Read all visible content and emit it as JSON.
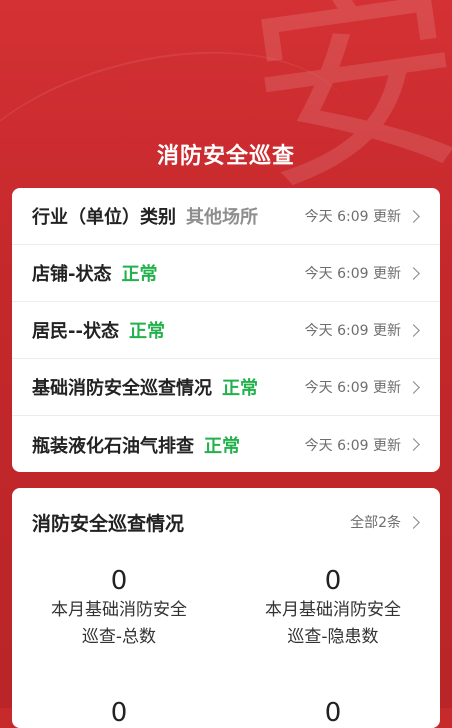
{
  "page_title": "消防安全巡查",
  "status_rows": [
    {
      "label": "行业（单位）类别",
      "value": "其他场所",
      "value_type": "other",
      "updated": "今天 6:09 更新"
    },
    {
      "label": "店铺-状态",
      "value": "正常",
      "value_type": "ok",
      "updated": "今天 6:09 更新"
    },
    {
      "label": "居民--状态",
      "value": "正常",
      "value_type": "ok",
      "updated": "今天 6:09 更新"
    },
    {
      "label": "基础消防安全巡查情况",
      "value": "正常",
      "value_type": "ok",
      "updated": "今天 6:09 更新"
    },
    {
      "label": "瓶装液化石油气排查",
      "value": "正常",
      "value_type": "ok",
      "updated": "今天 6:09 更新"
    }
  ],
  "inspection_card": {
    "title": "消防安全巡查情况",
    "all_link": "全部2条",
    "stats": [
      {
        "value": "0",
        "label_line1": "本月基础消防安全",
        "label_line2": "巡查-总数"
      },
      {
        "value": "0",
        "label_line1": "本月基础消防安全",
        "label_line2": "巡查-隐患数"
      },
      {
        "value": "0",
        "label_line1": "",
        "label_line2": ""
      },
      {
        "value": "0",
        "label_line1": "",
        "label_line2": ""
      }
    ]
  },
  "background": {
    "watermark_char": "安"
  },
  "colors": {
    "primary_red": "#c62a2b",
    "status_ok": "#22b14c",
    "status_other": "#8e8e8e"
  },
  "icons": {
    "row_arrow": "chevron-right-icon"
  }
}
